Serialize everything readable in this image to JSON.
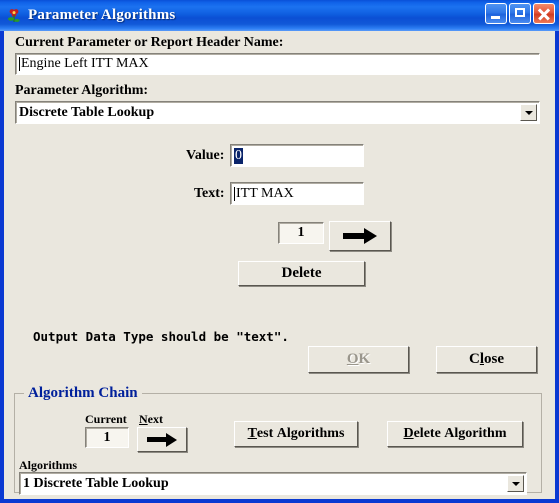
{
  "window": {
    "title": "Parameter Algorithms",
    "icon": "flower-icon",
    "minimize_label": "_",
    "maximize_label": "□",
    "close_label": "✕",
    "accent_titlebar": "#0f5fe0",
    "background": "#eae7de"
  },
  "form": {
    "current_parameter_label": "Current Parameter or Report Header Name:",
    "current_parameter_value": "Engine Left ITT MAX",
    "parameter_algorithm_label": "Parameter Algorithm:",
    "parameter_algorithm_value": "Discrete Table Lookup",
    "value_label": "Value:",
    "value_value": "0",
    "text_label": "Text:",
    "text_value": "ITT MAX",
    "index_value": "1",
    "next_arrow_icon": "right-arrow-icon",
    "delete_label": "Delete",
    "hint_text": "Output Data Type should be \"text\".",
    "ok_label": "OK",
    "ok_accel": "O",
    "ok_enabled": false,
    "close_label": "Close",
    "close_accel": "l"
  },
  "algorithm_chain": {
    "legend": "Algorithm Chain",
    "legend_color": "#00209b",
    "current_label": "Current",
    "current_value": "1",
    "next_label": "Next",
    "next_accel": "N",
    "next_arrow_icon": "right-arrow-icon",
    "test_algorithms_label": "Test Algorithms",
    "test_algorithms_accel": "T",
    "delete_algorithm_label": "Delete Algorithm",
    "delete_algorithm_accel": "D",
    "algorithms_label": "Algorithms",
    "algorithms_value": "1  Discrete Table Lookup"
  }
}
